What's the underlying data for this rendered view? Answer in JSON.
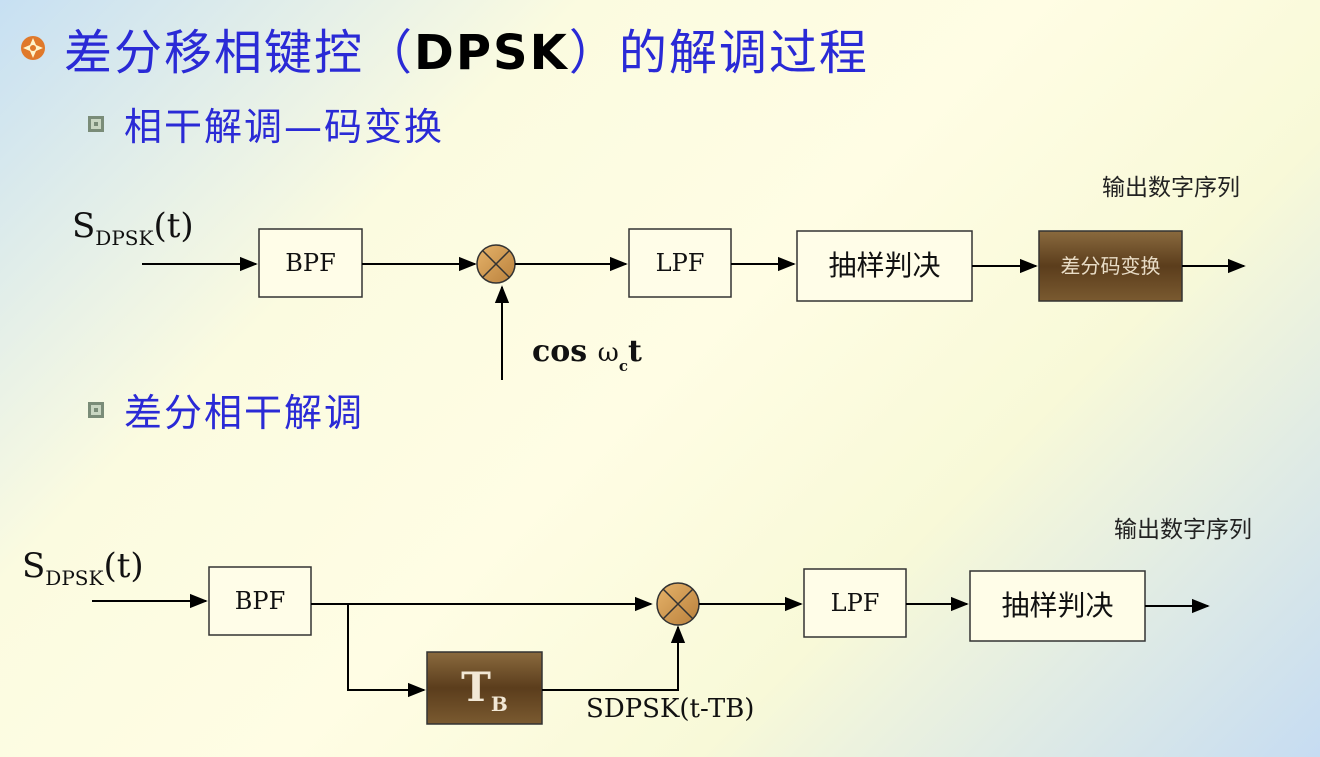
{
  "title": {
    "prefix": "差分移相键控（",
    "bold": "DPSK",
    "suffix": "）的解调过程"
  },
  "section1": {
    "label": "相干解调—码变换"
  },
  "section2": {
    "label": "差分相干解调"
  },
  "diagram1": {
    "input_main": "S",
    "input_sub": "DPSK",
    "input_arg": "(t)",
    "bpf": "BPF",
    "lpf": "LPF",
    "sampler": "抽样判决",
    "converter": "差分码变换",
    "carrier_cos": "cos",
    "carrier_omega": "ω",
    "carrier_sub": "c",
    "carrier_t": "t",
    "output": "输出数字序列"
  },
  "diagram2": {
    "input_main": "S",
    "input_sub": "DPSK",
    "input_arg": "(t)",
    "bpf": "BPF",
    "lpf": "LPF",
    "sampler": "抽样判决",
    "delay_main": "T",
    "delay_sub": "B",
    "delayed_main": "S",
    "delayed_sub": "DPSK",
    "delayed_arg_open": "(t-T",
    "delayed_arg_sub": "B",
    "delayed_arg_close": ")",
    "output": "输出数字序列"
  },
  "colors": {
    "title": "#2a2ad6",
    "delay_box": "#6b4a26",
    "bullet": "#e0792a"
  }
}
